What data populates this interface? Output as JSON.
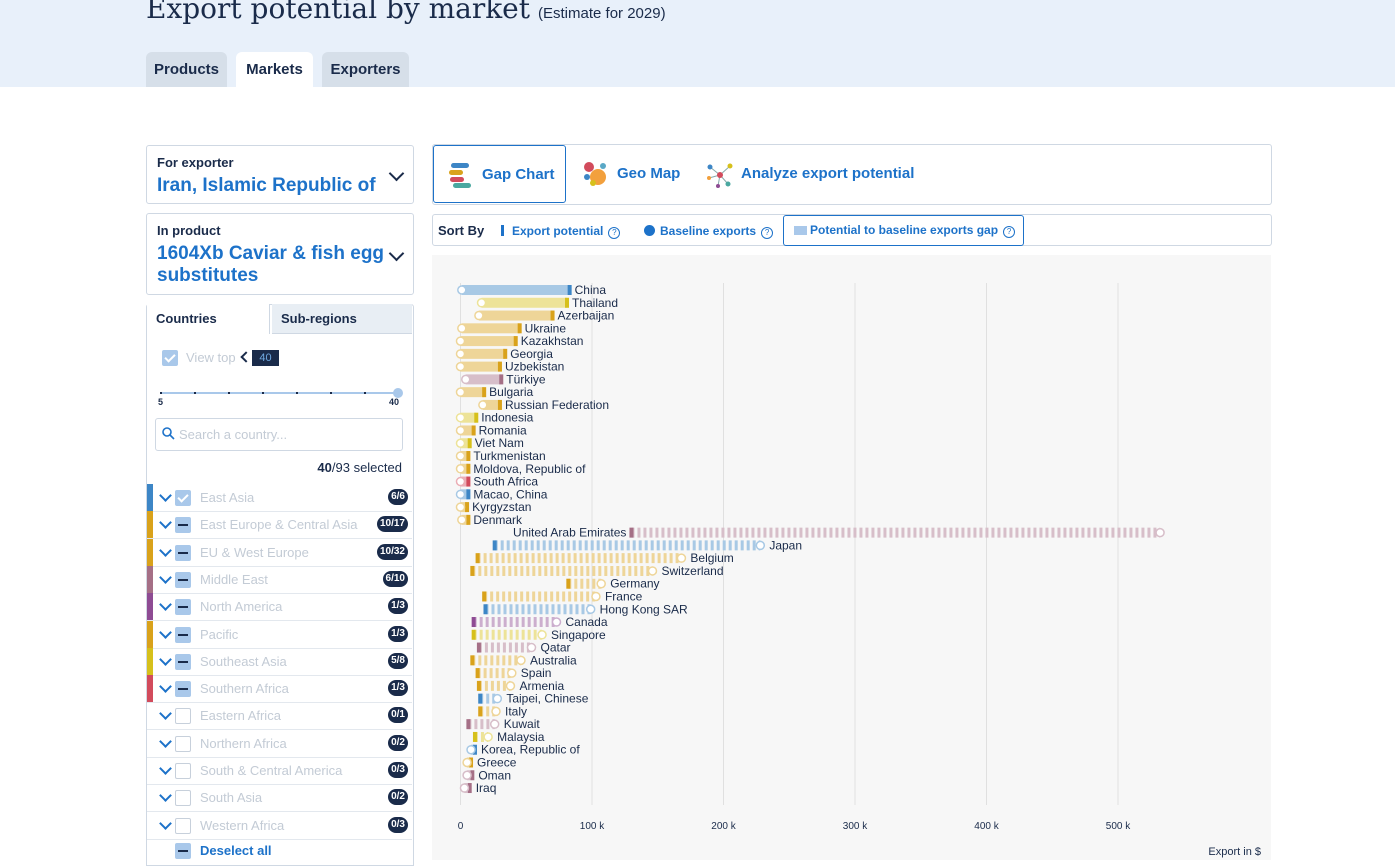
{
  "header": {
    "title": "Export potential by market",
    "subtitle": "(Estimate for 2029)"
  },
  "tabs": [
    "Products",
    "Markets",
    "Exporters"
  ],
  "filters": {
    "exporter_label": "For exporter",
    "exporter_value": "Iran, Islamic Republic of",
    "product_label": "In product",
    "product_value_line1": "1604Xb Caviar & fish egg",
    "product_value_line2": "substitutes"
  },
  "subtabs": [
    "Countries",
    "Sub-regions"
  ],
  "view_top": {
    "label": "View top",
    "value": "40",
    "slider_min": "5",
    "slider_max": "40",
    "slider_value": 40
  },
  "search": {
    "placeholder": "Search a country..."
  },
  "selection": {
    "count": "40",
    "total": "/93",
    "suffix": " selected"
  },
  "regions": [
    {
      "name": "East Asia",
      "badge": "6/6",
      "color": "#3d86c6",
      "state": "on"
    },
    {
      "name": "East Europe & Central Asia",
      "badge": "10/17",
      "color": "#d9a21b",
      "state": "part"
    },
    {
      "name": "EU & West Europe",
      "badge": "10/32",
      "color": "#d9a21b",
      "state": "part"
    },
    {
      "name": "Middle East",
      "badge": "6/10",
      "color": "#a56f86",
      "state": "part"
    },
    {
      "name": "North America",
      "badge": "1/3",
      "color": "#8e4b93",
      "state": "part"
    },
    {
      "name": "Pacific",
      "badge": "1/3",
      "color": "#d9a21b",
      "state": "part"
    },
    {
      "name": "Southeast Asia",
      "badge": "5/8",
      "color": "#d6c01b",
      "state": "part"
    },
    {
      "name": "Southern Africa",
      "badge": "1/3",
      "color": "#d24b5c",
      "state": "part"
    },
    {
      "name": "Eastern Africa",
      "badge": "0/1",
      "color": "",
      "state": "off"
    },
    {
      "name": "Northern Africa",
      "badge": "0/2",
      "color": "",
      "state": "off"
    },
    {
      "name": "South & Central America",
      "badge": "0/3",
      "color": "",
      "state": "off"
    },
    {
      "name": "South Asia",
      "badge": "0/2",
      "color": "",
      "state": "off"
    },
    {
      "name": "Western Africa",
      "badge": "0/3",
      "color": "",
      "state": "off"
    }
  ],
  "deselect_label": "Deselect all",
  "chart_tabs": [
    "Gap Chart",
    "Geo Map",
    "Analyze export potential"
  ],
  "sort": {
    "label": "Sort By",
    "options": [
      "Export potential",
      "Baseline exports",
      "Potential to baseline exports gap"
    ],
    "active": "Potential to baseline exports gap",
    "help_icon": "?"
  },
  "chart_data": {
    "type": "bar",
    "title": "",
    "xlabel": "Export in $",
    "xlim": [
      0,
      600000
    ],
    "ticks": [
      0,
      100000,
      200000,
      300000,
      400000,
      500000
    ],
    "tick_labels": [
      "0",
      "100 k",
      "200 k",
      "300 k",
      "400 k",
      "500 k"
    ],
    "legend": {
      "bar_end": "Export potential",
      "circle": "Baseline exports",
      "bar_span": "Potential to baseline exports gap"
    },
    "rows": [
      {
        "country": "China",
        "potential": 83000,
        "baseline": 1000,
        "color": "#3d86c6",
        "style": "solid"
      },
      {
        "country": "Thailand",
        "potential": 81000,
        "baseline": 16000,
        "color": "#d6c01b",
        "style": "solid"
      },
      {
        "country": "Azerbaijan",
        "potential": 70000,
        "baseline": 14000,
        "color": "#d9a21b",
        "style": "solid"
      },
      {
        "country": "Ukraine",
        "potential": 45000,
        "baseline": 1000,
        "color": "#d9a21b",
        "style": "solid"
      },
      {
        "country": "Kazakhstan",
        "potential": 42000,
        "baseline": 0,
        "color": "#d9a21b",
        "style": "solid"
      },
      {
        "country": "Georgia",
        "potential": 34000,
        "baseline": 0,
        "color": "#d9a21b",
        "style": "solid"
      },
      {
        "country": "Uzbekistan",
        "potential": 30000,
        "baseline": 0,
        "color": "#d9a21b",
        "style": "solid"
      },
      {
        "country": "Türkiye",
        "potential": 31000,
        "baseline": 4000,
        "color": "#a56f86",
        "style": "solid"
      },
      {
        "country": "Bulgaria",
        "potential": 18000,
        "baseline": 0,
        "color": "#d9a21b",
        "style": "solid"
      },
      {
        "country": "Russian Federation",
        "potential": 30000,
        "baseline": 17000,
        "color": "#d9a21b",
        "style": "solid"
      },
      {
        "country": "Indonesia",
        "potential": 12000,
        "baseline": 0,
        "color": "#d6c01b",
        "style": "solid"
      },
      {
        "country": "Romania",
        "potential": 10000,
        "baseline": 0,
        "color": "#d9a21b",
        "style": "solid"
      },
      {
        "country": "Viet Nam",
        "potential": 7000,
        "baseline": 0,
        "color": "#d6c01b",
        "style": "solid"
      },
      {
        "country": "Turkmenistan",
        "potential": 6000,
        "baseline": 0,
        "color": "#d9a21b",
        "style": "solid"
      },
      {
        "country": "Moldova, Republic of",
        "potential": 6000,
        "baseline": 0,
        "color": "#d9a21b",
        "style": "solid"
      },
      {
        "country": "South Africa",
        "potential": 6000,
        "baseline": 0,
        "color": "#d24b5c",
        "style": "solid"
      },
      {
        "country": "Macao, China",
        "potential": 6000,
        "baseline": 0,
        "color": "#3d86c6",
        "style": "solid"
      },
      {
        "country": "Kyrgyzstan",
        "potential": 5000,
        "baseline": 0,
        "color": "#d9a21b",
        "style": "solid"
      },
      {
        "country": "Denmark",
        "potential": 6000,
        "baseline": 1000,
        "color": "#d9a21b",
        "style": "solid"
      },
      {
        "country": "United Arab Emirates",
        "potential": 130000,
        "baseline": 532000,
        "color": "#a56f86",
        "style": "dashed"
      },
      {
        "country": "Japan",
        "potential": 26000,
        "baseline": 228000,
        "color": "#3d86c6",
        "style": "dashed"
      },
      {
        "country": "Belgium",
        "potential": 13000,
        "baseline": 168000,
        "color": "#d9a21b",
        "style": "dashed"
      },
      {
        "country": "Switzerland",
        "potential": 9000,
        "baseline": 146000,
        "color": "#d9a21b",
        "style": "dashed"
      },
      {
        "country": "Germany",
        "potential": 82000,
        "baseline": 107000,
        "color": "#d9a21b",
        "style": "dashed"
      },
      {
        "country": "France",
        "potential": 18000,
        "baseline": 103000,
        "color": "#d9a21b",
        "style": "dashed"
      },
      {
        "country": "Hong Kong SAR",
        "potential": 19000,
        "baseline": 99000,
        "color": "#3d86c6",
        "style": "dashed"
      },
      {
        "country": "Canada",
        "potential": 10000,
        "baseline": 73000,
        "color": "#8e4b93",
        "style": "dashed"
      },
      {
        "country": "Singapore",
        "potential": 10000,
        "baseline": 62000,
        "color": "#d6c01b",
        "style": "dashed"
      },
      {
        "country": "Qatar",
        "potential": 14000,
        "baseline": 54000,
        "color": "#a56f86",
        "style": "dashed"
      },
      {
        "country": "Australia",
        "potential": 9000,
        "baseline": 46000,
        "color": "#d9a21b",
        "style": "dashed"
      },
      {
        "country": "Spain",
        "potential": 13000,
        "baseline": 39000,
        "color": "#d9a21b",
        "style": "dashed"
      },
      {
        "country": "Armenia",
        "potential": 14000,
        "baseline": 38000,
        "color": "#d9a21b",
        "style": "dashed"
      },
      {
        "country": "Taipei, Chinese",
        "potential": 15000,
        "baseline": 28000,
        "color": "#3d86c6",
        "style": "dashed"
      },
      {
        "country": "Italy",
        "potential": 15000,
        "baseline": 27000,
        "color": "#d9a21b",
        "style": "dashed"
      },
      {
        "country": "Kuwait",
        "potential": 6000,
        "baseline": 26000,
        "color": "#a56f86",
        "style": "dashed"
      },
      {
        "country": "Malaysia",
        "potential": 11000,
        "baseline": 21000,
        "color": "#d6c01b",
        "style": "dashed"
      },
      {
        "country": "Korea, Republic of",
        "potential": 11000,
        "baseline": 8000,
        "color": "#3d86c6",
        "style": "dashed"
      },
      {
        "country": "Greece",
        "potential": 8000,
        "baseline": 5000,
        "color": "#d9a21b",
        "style": "dashed"
      },
      {
        "country": "Oman",
        "potential": 9000,
        "baseline": 5000,
        "color": "#a56f86",
        "style": "dashed"
      },
      {
        "country": "Iraq",
        "potential": 7000,
        "baseline": 3000,
        "color": "#a56f86",
        "style": "dashed"
      }
    ]
  }
}
